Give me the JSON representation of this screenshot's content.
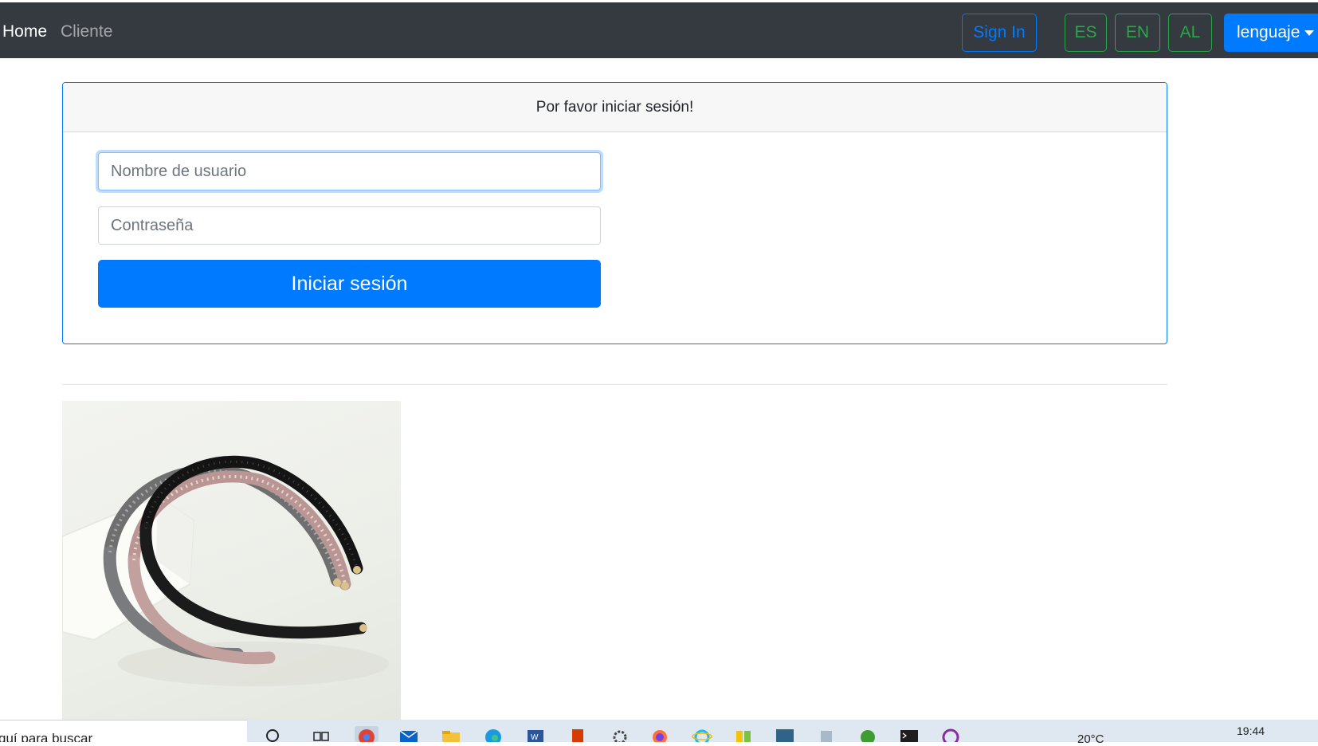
{
  "navbar": {
    "home": "Home",
    "cliente": "Cliente",
    "sign_in": "Sign In",
    "lang_es": "ES",
    "lang_en": "EN",
    "lang_al": "AL",
    "dropdown": "lenguaje"
  },
  "login_card": {
    "header": "Por favor iniciar sesión!",
    "username_placeholder": "Nombre de usuario",
    "password_placeholder": "Contraseña",
    "submit": "Iniciar sesión"
  },
  "taskbar": {
    "search_text": "quí para buscar",
    "weather": "20°C",
    "time": "19:44",
    "icons": [
      "search-icon",
      "task-view-icon",
      "chrome-icon",
      "mail-icon",
      "file-explorer-icon",
      "edge-icon",
      "word-icon",
      "office-icon",
      "settings-icon",
      "firefox-icon",
      "internet-explorer-icon",
      "app-icon",
      "mysql-icon",
      "app-icon",
      "app-icon",
      "terminal-icon",
      "app-icon"
    ]
  },
  "colors": {
    "navbar_bg": "#343a40",
    "primary": "#007bff",
    "success": "#28a745"
  }
}
